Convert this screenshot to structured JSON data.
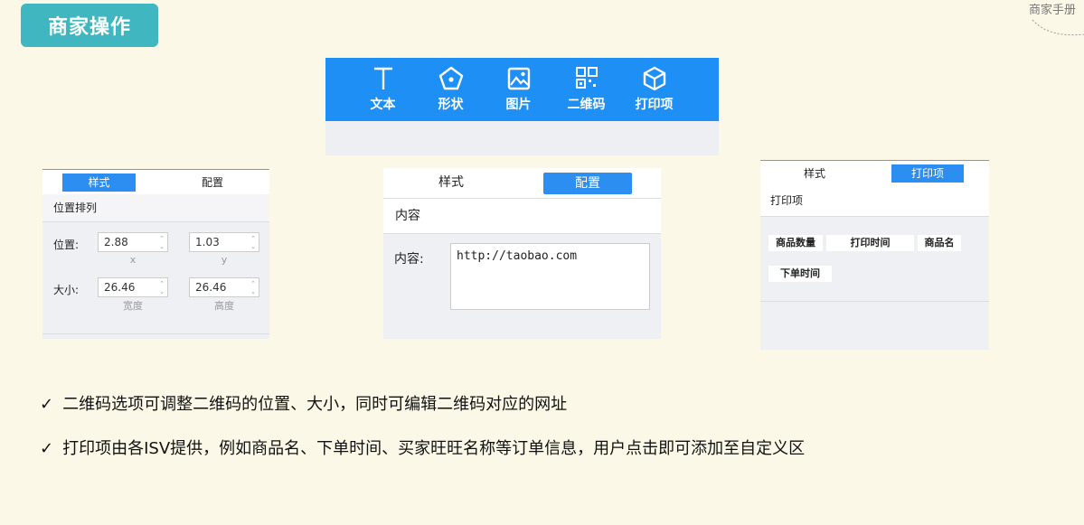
{
  "header": {
    "title": "商家操作",
    "corner_label": "商家手册"
  },
  "toolbar": {
    "items": [
      {
        "label": "文本",
        "icon": "text-icon"
      },
      {
        "label": "形状",
        "icon": "shape-icon"
      },
      {
        "label": "图片",
        "icon": "image-icon"
      },
      {
        "label": "二维码",
        "icon": "qrcode-icon"
      },
      {
        "label": "打印项",
        "icon": "cube-icon"
      }
    ]
  },
  "panel_style": {
    "tabs": [
      "样式",
      "配置"
    ],
    "section": "位置排列",
    "position_label": "位置:",
    "size_label": "大小:",
    "x_value": "2.88",
    "y_value": "1.03",
    "x_sub": "x",
    "y_sub": "y",
    "width_value": "26.46",
    "height_value": "26.46",
    "width_sub": "宽度",
    "height_sub": "高度"
  },
  "panel_config": {
    "tabs": [
      "样式",
      "配置"
    ],
    "section": "内容",
    "content_label": "内容:",
    "content_value": "http://taobao.com"
  },
  "panel_print": {
    "tabs": [
      "样式",
      "打印项"
    ],
    "section": "打印项",
    "items": [
      "商品数量",
      "打印时间",
      "商品名",
      "下单时间"
    ]
  },
  "bullets": [
    "二维码选项可调整二维码的位置、大小，同时可编辑二维码对应的网址",
    "打印项由各ISV提供，例如商品名、下单时间、买家旺旺名称等订单信息，用户点击即可添加至自定义区"
  ],
  "check_glyph": "✓",
  "colors": {
    "accent": "#3fb6c0",
    "blue": "#1e90f5",
    "tab_active": "#2b8ef0"
  }
}
